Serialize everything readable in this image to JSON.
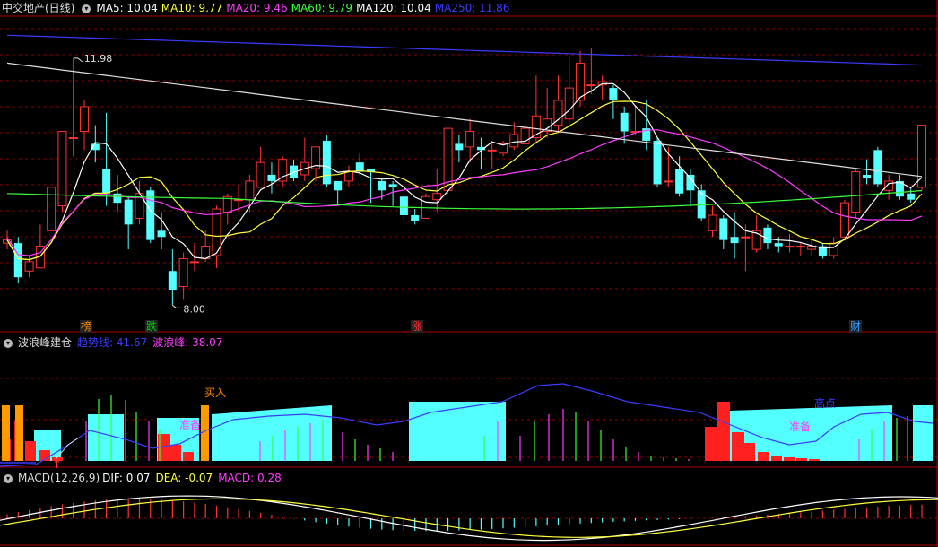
{
  "main": {
    "title": "中交地产(日线)",
    "ma": [
      {
        "label": "MA5: 10.04",
        "color": "#ffffff"
      },
      {
        "label": "MA10: 9.77",
        "color": "#ffff3c"
      },
      {
        "label": "MA20: 9.46",
        "color": "#ff3cff"
      },
      {
        "label": "MA60: 9.79",
        "color": "#3cff3c"
      },
      {
        "label": "MA120: 10.04",
        "color": "#ffffff"
      },
      {
        "label": "MA250: 11.86",
        "color": "#3c3cff"
      }
    ],
    "high_label": "11.98",
    "low_label": "8.00",
    "badges": [
      {
        "text": "榜",
        "color": "#ff8800"
      },
      {
        "text": "跌",
        "color": "#00cc00"
      },
      {
        "text": "涨",
        "color": "#ff3333"
      },
      {
        "text": "财",
        "color": "#3399ff"
      }
    ],
    "candles": [
      {
        "o": 9.0,
        "c": 9.05,
        "h": 9.2,
        "l": 8.9
      },
      {
        "o": 9.0,
        "c": 8.45,
        "h": 9.1,
        "l": 8.35
      },
      {
        "o": 8.55,
        "c": 8.7,
        "h": 8.8,
        "l": 8.45
      },
      {
        "o": 8.6,
        "c": 8.95,
        "h": 9.3,
        "l": 8.6
      },
      {
        "o": 9.2,
        "c": 9.9,
        "h": 9.9,
        "l": 9.2
      },
      {
        "o": 9.6,
        "c": 10.8,
        "h": 10.8,
        "l": 9.5
      },
      {
        "o": 10.7,
        "c": 10.7,
        "h": 11.98,
        "l": 10.4
      },
      {
        "o": 10.8,
        "c": 11.2,
        "h": 11.3,
        "l": 10.5
      },
      {
        "o": 10.6,
        "c": 10.5,
        "h": 10.9,
        "l": 10.3
      },
      {
        "o": 10.2,
        "c": 9.8,
        "h": 11.1,
        "l": 9.6
      },
      {
        "o": 9.8,
        "c": 9.65,
        "h": 10.1,
        "l": 9.5
      },
      {
        "o": 9.7,
        "c": 9.3,
        "h": 9.75,
        "l": 8.9
      },
      {
        "o": 9.4,
        "c": 9.8,
        "h": 10.0,
        "l": 9.3
      },
      {
        "o": 9.85,
        "c": 9.05,
        "h": 9.9,
        "l": 9.0
      },
      {
        "o": 9.2,
        "c": 9.1,
        "h": 9.5,
        "l": 8.9
      },
      {
        "o": 8.55,
        "c": 8.25,
        "h": 8.9,
        "l": 8.0
      },
      {
        "o": 8.3,
        "c": 8.75,
        "h": 8.85,
        "l": 8.1
      },
      {
        "o": 8.7,
        "c": 8.7,
        "h": 9.0,
        "l": 8.55
      },
      {
        "o": 8.75,
        "c": 8.95,
        "h": 9.2,
        "l": 8.7
      },
      {
        "o": 8.8,
        "c": 9.55,
        "h": 9.6,
        "l": 8.6
      },
      {
        "o": 9.5,
        "c": 9.75,
        "h": 9.8,
        "l": 9.3
      },
      {
        "o": 9.7,
        "c": 9.7,
        "h": 9.95,
        "l": 9.5
      },
      {
        "o": 9.7,
        "c": 10.0,
        "h": 10.1,
        "l": 9.5
      },
      {
        "o": 9.9,
        "c": 10.3,
        "h": 10.55,
        "l": 9.9
      },
      {
        "o": 10.1,
        "c": 10.0,
        "h": 10.3,
        "l": 9.8
      },
      {
        "o": 10.0,
        "c": 10.35,
        "h": 10.4,
        "l": 9.9
      },
      {
        "o": 10.25,
        "c": 10.05,
        "h": 10.35,
        "l": 10.0
      },
      {
        "o": 10.1,
        "c": 10.3,
        "h": 10.7,
        "l": 10.0
      },
      {
        "o": 10.2,
        "c": 10.55,
        "h": 10.55,
        "l": 10.0
      },
      {
        "o": 10.65,
        "c": 9.95,
        "h": 10.75,
        "l": 9.9
      },
      {
        "o": 10.0,
        "c": 9.85,
        "h": 10.0,
        "l": 9.6
      },
      {
        "o": 10.0,
        "c": 10.15,
        "h": 10.25,
        "l": 9.9
      },
      {
        "o": 10.3,
        "c": 10.15,
        "h": 10.45,
        "l": 10.1
      },
      {
        "o": 10.2,
        "c": 10.15,
        "h": 10.2,
        "l": 9.65
      },
      {
        "o": 10.0,
        "c": 9.85,
        "h": 10.05,
        "l": 9.7
      },
      {
        "o": 9.95,
        "c": 9.9,
        "h": 10.0,
        "l": 9.6
      },
      {
        "o": 9.75,
        "c": 9.45,
        "h": 9.8,
        "l": 9.35
      },
      {
        "o": 9.45,
        "c": 9.35,
        "h": 9.55,
        "l": 9.3
      },
      {
        "o": 9.4,
        "c": 9.75,
        "h": 9.8,
        "l": 9.4
      },
      {
        "o": 9.7,
        "c": 9.8,
        "h": 10.2,
        "l": 9.5
      },
      {
        "o": 9.85,
        "c": 10.85,
        "h": 10.85,
        "l": 9.8
      },
      {
        "o": 10.6,
        "c": 10.5,
        "h": 10.75,
        "l": 10.3
      },
      {
        "o": 10.55,
        "c": 10.8,
        "h": 11.0,
        "l": 10.3
      },
      {
        "o": 10.55,
        "c": 10.5,
        "h": 10.7,
        "l": 10.2
      },
      {
        "o": 10.5,
        "c": 10.5,
        "h": 10.65,
        "l": 10.2
      },
      {
        "o": 10.45,
        "c": 10.6,
        "h": 10.65,
        "l": 10.4
      },
      {
        "o": 10.55,
        "c": 10.75,
        "h": 10.95,
        "l": 10.5
      },
      {
        "o": 10.6,
        "c": 10.85,
        "h": 11.0,
        "l": 10.5
      },
      {
        "o": 10.7,
        "c": 11.05,
        "h": 11.7,
        "l": 10.6
      },
      {
        "o": 10.8,
        "c": 11.0,
        "h": 11.5,
        "l": 10.7
      },
      {
        "o": 10.9,
        "c": 11.3,
        "h": 11.7,
        "l": 10.8
      },
      {
        "o": 11.0,
        "c": 11.5,
        "h": 12.0,
        "l": 10.9
      },
      {
        "o": 11.3,
        "c": 11.9,
        "h": 12.1,
        "l": 11.2
      },
      {
        "o": 11.55,
        "c": 11.55,
        "h": 12.15,
        "l": 11.4
      },
      {
        "o": 11.55,
        "c": 11.6,
        "h": 11.7,
        "l": 11.3
      },
      {
        "o": 11.5,
        "c": 11.3,
        "h": 11.55,
        "l": 11.0
      },
      {
        "o": 11.1,
        "c": 10.8,
        "h": 11.2,
        "l": 10.6
      },
      {
        "o": 10.8,
        "c": 10.8,
        "h": 11.2,
        "l": 10.75
      },
      {
        "o": 10.85,
        "c": 10.65,
        "h": 11.3,
        "l": 10.5
      },
      {
        "o": 10.65,
        "c": 9.95,
        "h": 10.7,
        "l": 9.9
      },
      {
        "o": 10.0,
        "c": 10.0,
        "h": 10.55,
        "l": 9.9
      },
      {
        "o": 10.2,
        "c": 9.8,
        "h": 10.4,
        "l": 9.75
      },
      {
        "o": 10.1,
        "c": 9.85,
        "h": 10.2,
        "l": 9.6
      },
      {
        "o": 9.85,
        "c": 9.4,
        "h": 9.95,
        "l": 9.35
      },
      {
        "o": 9.2,
        "c": 9.45,
        "h": 9.6,
        "l": 9.1
      },
      {
        "o": 9.4,
        "c": 9.05,
        "h": 9.45,
        "l": 8.9
      },
      {
        "o": 9.1,
        "c": 9.0,
        "h": 9.5,
        "l": 8.75
      },
      {
        "o": 9.1,
        "c": 9.1,
        "h": 9.3,
        "l": 8.55
      },
      {
        "o": 8.9,
        "c": 9.2,
        "h": 9.45,
        "l": 8.85
      },
      {
        "o": 9.25,
        "c": 9.0,
        "h": 9.3,
        "l": 8.9
      },
      {
        "o": 9.0,
        "c": 8.95,
        "h": 9.1,
        "l": 8.85
      },
      {
        "o": 8.95,
        "c": 8.95,
        "h": 9.15,
        "l": 8.85
      },
      {
        "o": 8.95,
        "c": 8.95,
        "h": 9.0,
        "l": 8.8
      },
      {
        "o": 8.9,
        "c": 8.95,
        "h": 9.05,
        "l": 8.8
      },
      {
        "o": 8.95,
        "c": 8.8,
        "h": 9.0,
        "l": 8.75
      },
      {
        "o": 8.8,
        "c": 9.0,
        "h": 9.1,
        "l": 8.75
      },
      {
        "o": 9.1,
        "c": 9.65,
        "h": 9.7,
        "l": 9.05
      },
      {
        "o": 9.5,
        "c": 10.15,
        "h": 10.2,
        "l": 9.4
      },
      {
        "o": 10.1,
        "c": 10.05,
        "h": 10.35,
        "l": 9.95
      },
      {
        "o": 10.5,
        "c": 9.95,
        "h": 10.55,
        "l": 9.9
      },
      {
        "o": 9.85,
        "c": 10.0,
        "h": 10.1,
        "l": 9.7
      },
      {
        "o": 10.0,
        "c": 9.75,
        "h": 10.1,
        "l": 9.7
      },
      {
        "o": 9.8,
        "c": 9.7,
        "h": 9.9,
        "l": 9.65
      },
      {
        "o": 9.9,
        "c": 10.9,
        "h": 10.9,
        "l": 9.85
      }
    ]
  },
  "indicator": {
    "name": "波浪峰建仓",
    "trend_label": "趋势线: 41.67",
    "peak_label": "波浪峰: 38.07",
    "buy_label": "买入",
    "prep_label_1": "准备",
    "prep_label_2": "准备",
    "peak_tag": "高点"
  },
  "macd": {
    "title": "MACD(12,26,9)",
    "dif": "DIF: 0.07",
    "dea": "DEA: -0.07",
    "macd": "MACD: 0.28"
  },
  "colors": {
    "up": "#ff3232",
    "down": "#54ffff",
    "grid": "#8b0000",
    "border": "#b00000",
    "ma5": "#ffffff",
    "ma10": "#ffff3c",
    "ma20": "#ff3cff",
    "ma60": "#3cff3c",
    "ma120": "#dddddd",
    "ma250": "#3c3cff"
  }
}
